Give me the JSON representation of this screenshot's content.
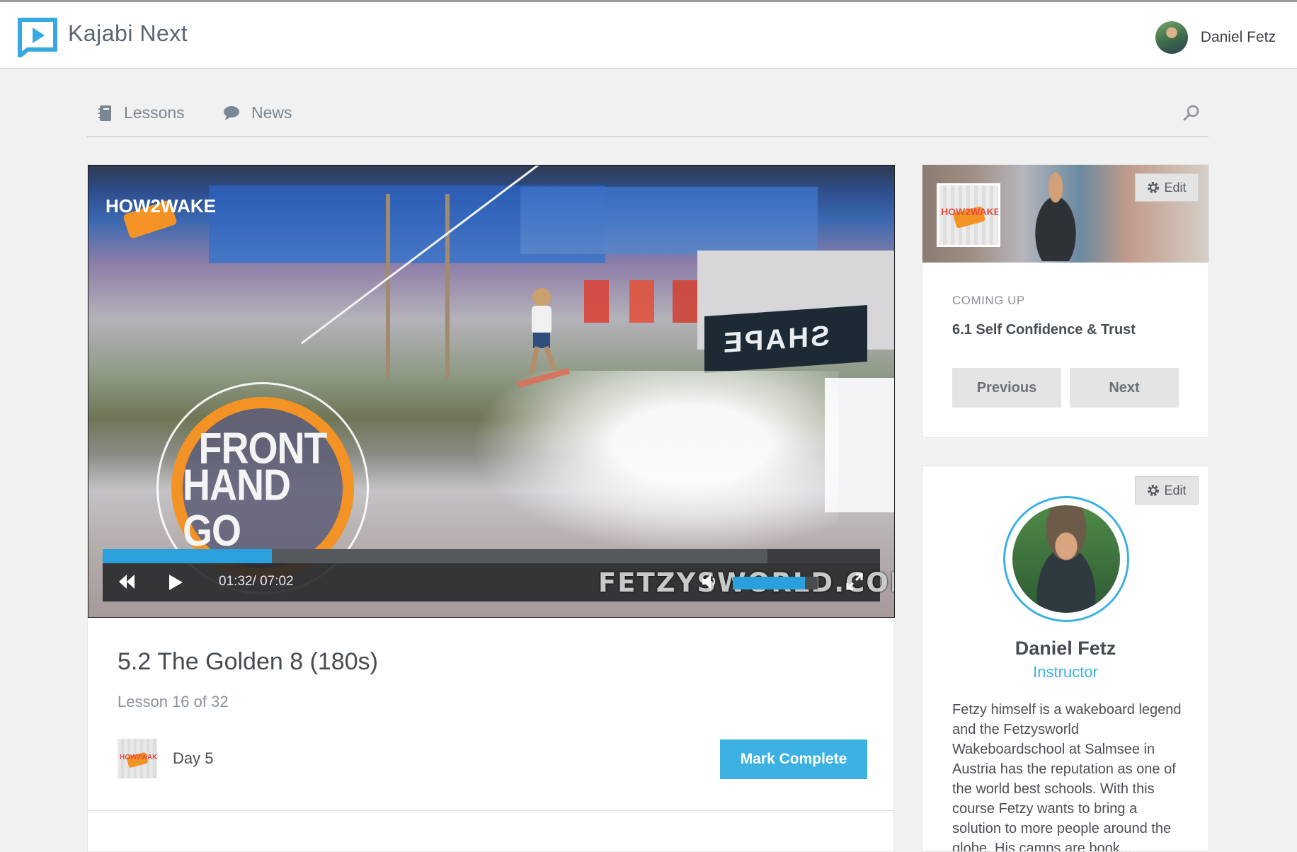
{
  "app": {
    "brand": "Kajabi Next"
  },
  "user": {
    "name": "Daniel Fetz"
  },
  "nav": {
    "items": [
      {
        "label": "Lessons",
        "icon": "book-icon"
      },
      {
        "label": "News",
        "icon": "speech-bubble-icon"
      }
    ],
    "search_icon": "search-icon"
  },
  "video": {
    "logo_text": "HOW2WAKE",
    "overlay_line1": "FRONT",
    "overlay_line2": "HAND GO",
    "banner_text": "SHAPE",
    "time": "01:32/ 07:02",
    "watermark": "FETZYSWORLD.COM",
    "progress_fraction": 0.218,
    "buffered_fraction": 0.855,
    "volume_fraction": 0.85
  },
  "lesson": {
    "title": "5.2 The Golden 8 (180s)",
    "count": "Lesson 16 of 32",
    "module": "Day 5",
    "mark_complete": "Mark Complete"
  },
  "coming_up": {
    "label": "COMING UP",
    "title": "6.1 Self Confidence & Trust",
    "edit": "Edit",
    "previous": "Previous",
    "next": "Next"
  },
  "instructor": {
    "edit": "Edit",
    "name": "Daniel Fetz",
    "role": "Instructor",
    "bio": "Fetzy himself is a wakeboard legend and the Fetzysworld Wakeboardschool at Salmsee in Austria has the reputation as one of the world best schools. With this course Fetzy wants to bring a solution to more people around the globe. His camps are book..."
  },
  "colors": {
    "accent": "#3bb2e2",
    "logo_blue": "#36a9e1",
    "badge_orange": "#f39325"
  }
}
